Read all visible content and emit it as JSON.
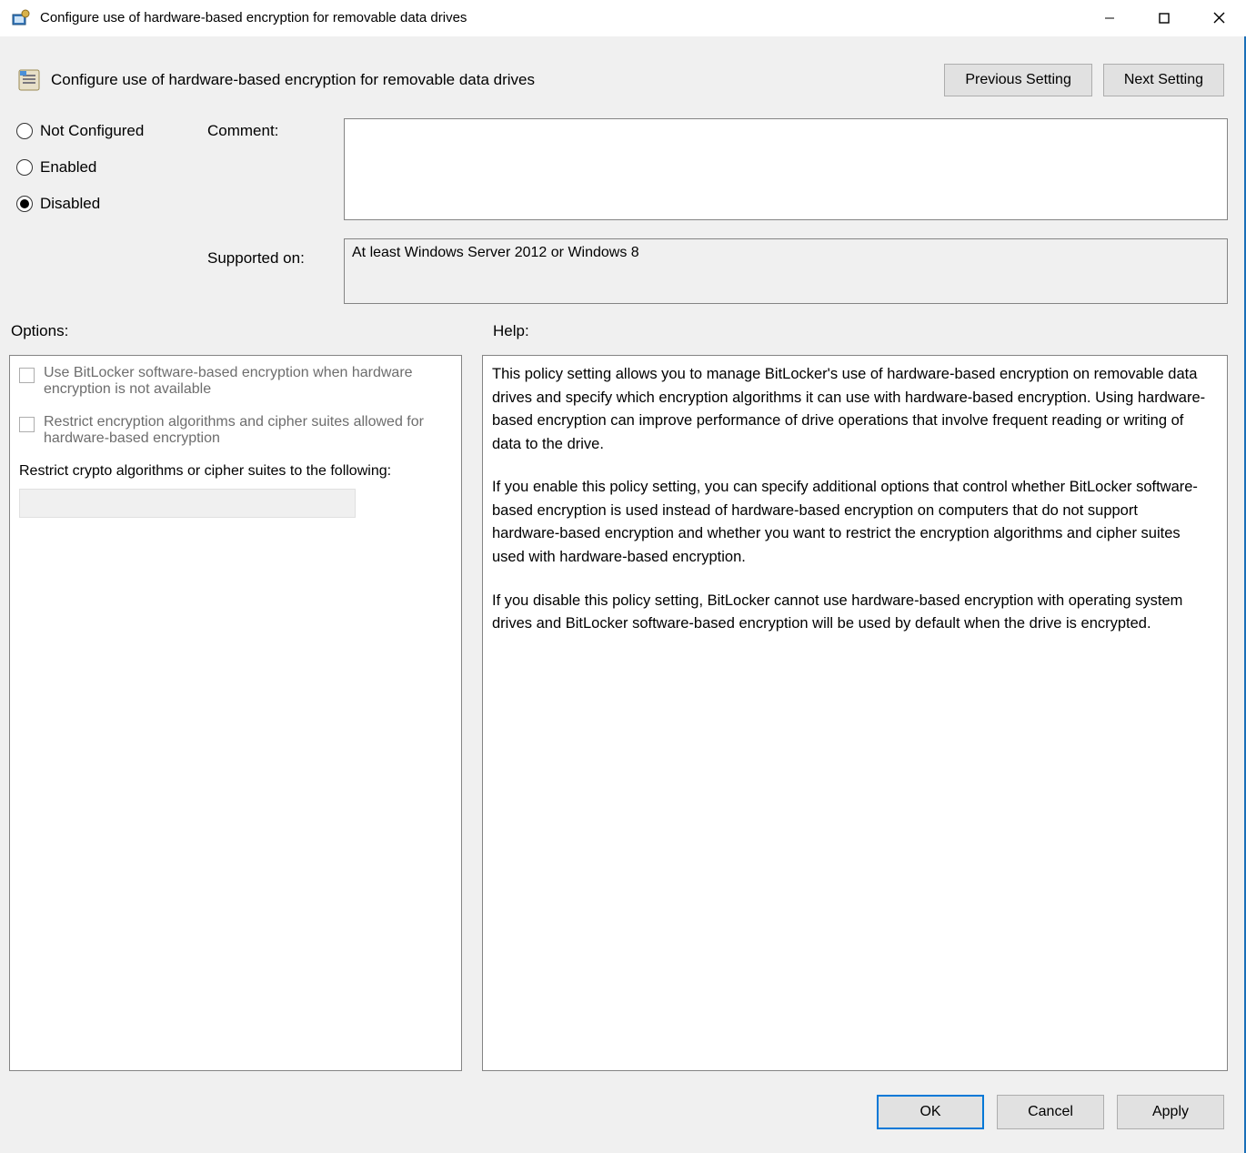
{
  "window": {
    "title": "Configure use of hardware-based encryption for removable data drives"
  },
  "header": {
    "policy_title": "Configure use of hardware-based encryption for removable data drives",
    "prev_button": "Previous Setting",
    "next_button": "Next Setting"
  },
  "state": {
    "not_configured": "Not Configured",
    "enabled": "Enabled",
    "disabled": "Disabled",
    "selected": "disabled"
  },
  "labels": {
    "comment": "Comment:",
    "supported_on": "Supported on:",
    "options": "Options:",
    "help": "Help:"
  },
  "fields": {
    "comment_value": "",
    "supported_on_value": "At least Windows Server 2012 or Windows 8"
  },
  "options": {
    "chk1": "Use BitLocker software-based encryption when hardware encryption is not available",
    "chk2": "Restrict encryption algorithms and cipher suites allowed for hardware-based encryption",
    "restrict_label": "Restrict crypto algorithms or cipher suites to the following:"
  },
  "help": {
    "p1": "This policy setting allows you to manage BitLocker's use of hardware-based encryption on removable data drives and specify which encryption algorithms it can use with hardware-based encryption. Using hardware-based encryption can improve performance of drive operations that involve frequent reading or writing of data to the drive.",
    "p2": "If you enable this policy setting, you can specify additional options that control whether BitLocker software-based encryption is used instead of hardware-based encryption on computers that do not support hardware-based encryption and whether you want to restrict the encryption algorithms and cipher suites used with hardware-based encryption.",
    "p3": "If you disable this policy setting, BitLocker cannot use hardware-based encryption with operating system drives and BitLocker software-based encryption will be used by default when the drive is encrypted."
  },
  "footer": {
    "ok": "OK",
    "cancel": "Cancel",
    "apply": "Apply"
  }
}
